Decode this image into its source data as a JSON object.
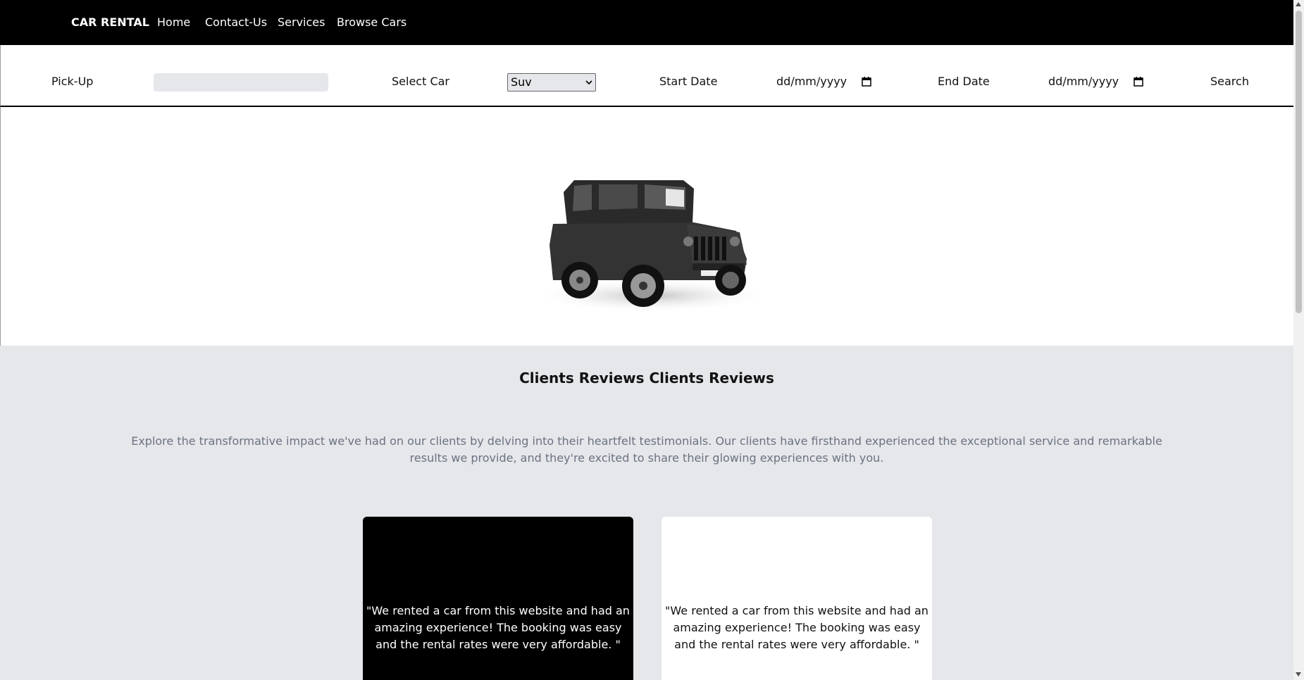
{
  "nav": {
    "brand": "CAR RENTAL",
    "links": [
      "Home",
      "Contact-Us",
      "Services",
      "Browse Cars"
    ]
  },
  "search": {
    "pickup_label": "Pick-Up",
    "pickup_value": "",
    "car_label": "Select Car",
    "car_selected": "Suv",
    "start_label": "Start Date",
    "start_placeholder": "dd/mm/yyyy",
    "end_label": "End Date",
    "end_placeholder": "dd/mm/yyyy",
    "search_label": "Search"
  },
  "reviews": {
    "title": "Clients Reviews Clients Reviews",
    "description": "Explore the transformative impact we've had on our clients by delving into their heartfelt testimonials. Our clients have firsthand experienced the exceptional service and remarkable results we provide, and they're excited to share their glowing experiences with you.",
    "cards": [
      {
        "quote": "\"We rented a car from this website and had an amazing experience! The booking was easy and the rental rates were very affordable. \""
      },
      {
        "quote": "\"We rented a car from this website and had an amazing experience! The booking was easy and the rental rates were very affordable. \""
      }
    ]
  },
  "colors": {
    "nav_bg": "#000000",
    "reviews_bg": "#e5e7eb",
    "desc_text": "#6b7280"
  },
  "icons": [
    "calendar-icon",
    "chevron-down-icon",
    "car-image"
  ]
}
